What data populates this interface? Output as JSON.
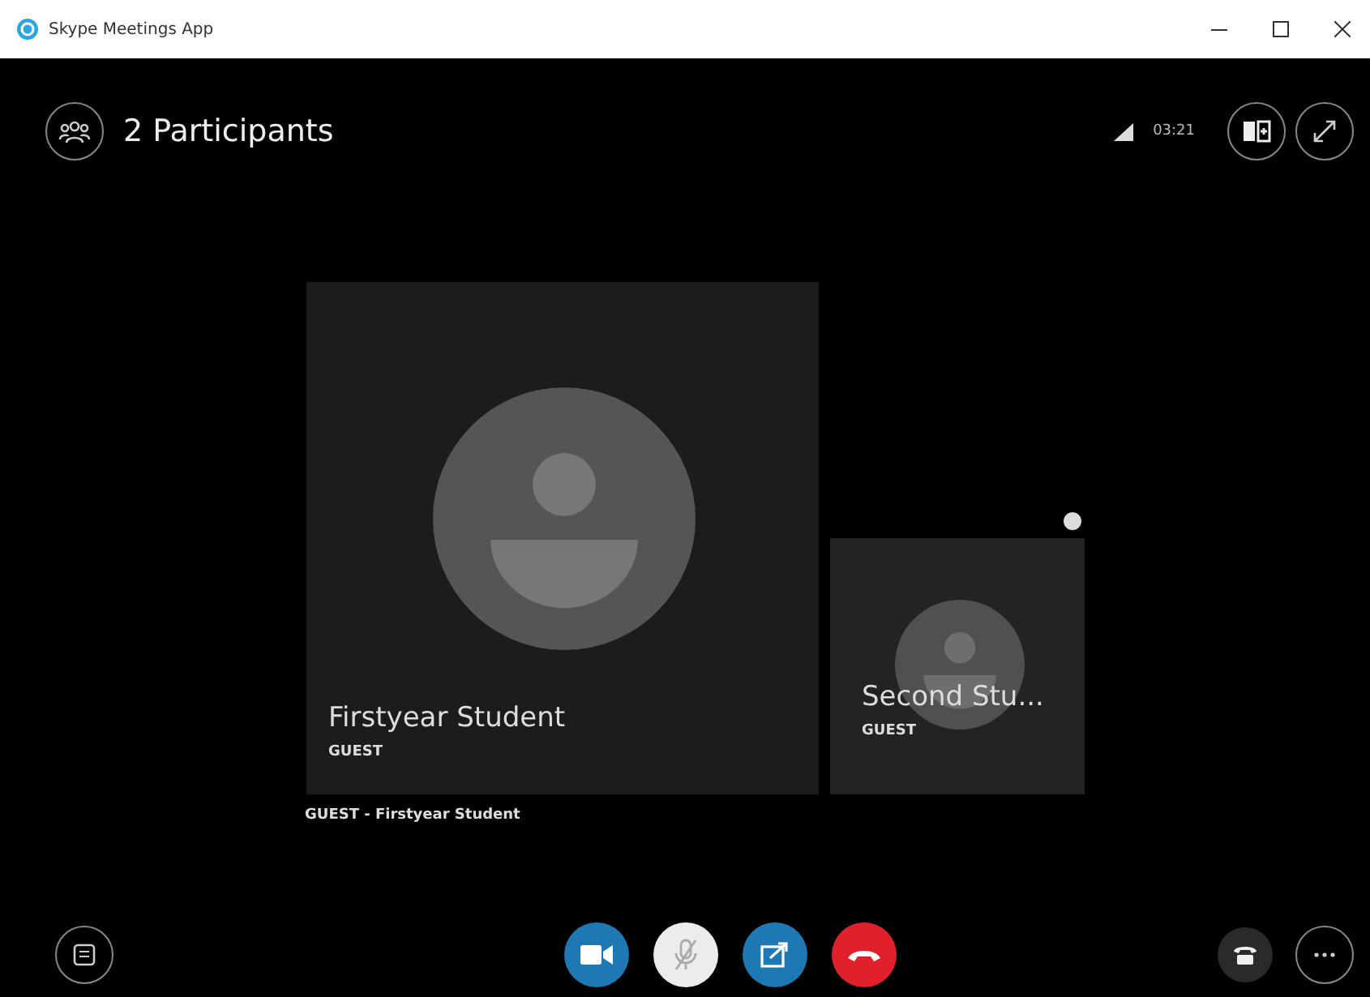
{
  "window": {
    "title": "Skype Meetings App"
  },
  "header": {
    "participants": "2 Participants",
    "time": "03:21"
  },
  "tiles": [
    {
      "name": "Firstyear Student",
      "role": "GUEST",
      "kind": "large"
    },
    {
      "name": "Second Stu...",
      "role": "GUEST",
      "kind": "small"
    }
  ],
  "caption": "GUEST - Firstyear Student",
  "controls": [
    {
      "kind": "video",
      "on": true
    },
    {
      "kind": "mic",
      "muted": true
    },
    {
      "kind": "share",
      "on": true
    },
    {
      "kind": "hangup",
      "on": true
    }
  ]
}
